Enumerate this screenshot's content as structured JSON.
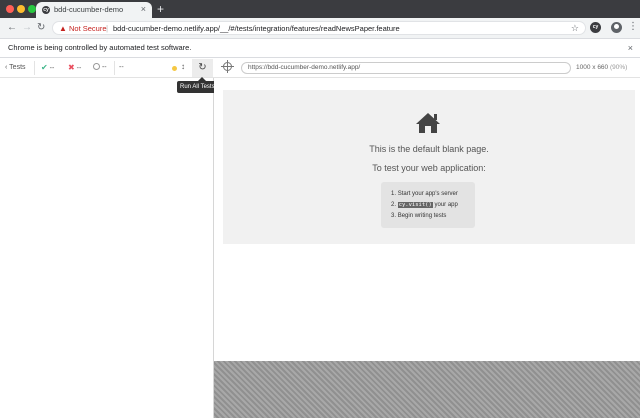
{
  "browser": {
    "tab_title": "bdd-cucumber-demo",
    "favicon_letter": "cy",
    "new_tab_label": "+",
    "security_label": "Not Secure",
    "url": "bdd-cucumber-demo.netlify.app/__/#/tests/integration/features/readNewsPaper.feature",
    "extension_letter": "cy",
    "colors": {
      "close": "#ff5f57",
      "minimize": "#febc2e",
      "maximize": "#28c840"
    }
  },
  "infobar": {
    "message": "Chrome is being controlled by automated test software."
  },
  "reporter": {
    "tests_label": "Tests",
    "passed": "--",
    "failed": "--",
    "pending": "--",
    "duration": "--",
    "tooltip_label": "Run All Tests",
    "tooltip_key": "R"
  },
  "runner": {
    "aut_url": "https://bdd-cucumber-demo.netlify.app/",
    "viewport_size": "1000 x 660",
    "viewport_zoom": "(90%)",
    "blank_title": "This is the default blank page.",
    "blank_subtitle": "To test your web application:",
    "steps": [
      {
        "num": "1.",
        "text": "Start your app's server"
      },
      {
        "num": "2.",
        "code": "cy.visit()",
        "text": "your app"
      },
      {
        "num": "3.",
        "text": "Begin writing tests"
      }
    ]
  },
  "icons": [
    "chevron-left-icon",
    "check-icon",
    "cross-icon",
    "pending-icon",
    "reload-icon",
    "crosshair-icon",
    "home-icon",
    "warning-icon",
    "star-icon",
    "account-icon",
    "menu-icon"
  ]
}
